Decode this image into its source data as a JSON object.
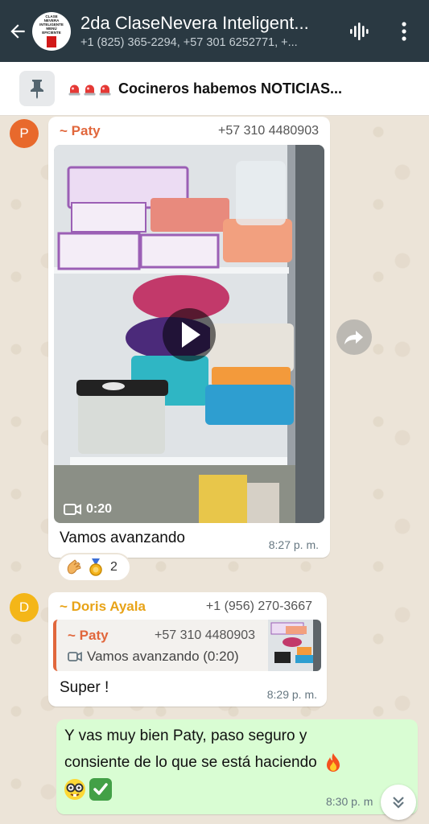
{
  "header": {
    "title": "2da ClaseNevera Inteligent...",
    "subtitle": "+1 (825) 365-2294, +57 301 6252771, +...",
    "avatar_text": "CLASE NEVERA INTELIGENTE MENÚ EFICIENTE"
  },
  "pinned": {
    "text": "Cocineros habemos NOTICIAS..."
  },
  "messages": [
    {
      "avatar_letter": "P",
      "avatar_color": "#e8692c",
      "sender": "~ Paty",
      "sender_color": "#e1673c",
      "phone": "+57 310 4480903",
      "video_duration": "0:20",
      "text": "Vamos avanzando",
      "time": "8:27 p. m.",
      "reaction_count": "2"
    },
    {
      "avatar_letter": "D",
      "avatar_color": "#f4b618",
      "sender": "~ Doris Ayala",
      "sender_color": "#e8a317",
      "phone": "+1 (956) 270-3667",
      "quote": {
        "sender": "~ Paty",
        "phone": "+57 310 4480903",
        "text": "Vamos avanzando (0:20)"
      },
      "text": "Super !",
      "time": "8:29 p. m."
    },
    {
      "text_line1": "Y vas muy bien Paty, paso seguro y",
      "text_line2": "consiente de lo que se está haciendo",
      "time": "8:30 p. m"
    }
  ]
}
